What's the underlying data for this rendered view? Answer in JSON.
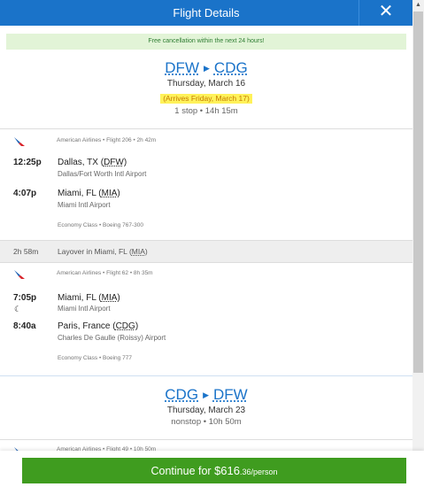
{
  "header": {
    "title": "Flight Details",
    "close_icon": "close-icon"
  },
  "notice": "Free cancellation within the next 24 hours!",
  "outbound": {
    "from": "DFW",
    "to": "CDG",
    "date": "Thursday, March 16",
    "arrives": "(Arrives Friday, March 17)",
    "stops": "1 stop • 14h 15m"
  },
  "segments": [
    {
      "airline": "American Airlines • Flight 206 • 2h 42m",
      "depart_time": "12:25p",
      "depart_city": "Dallas, TX",
      "depart_code": "DFW",
      "depart_airport": "Dallas/Fort Worth Intl Airport",
      "arrive_time": "4:07p",
      "arrive_city": "Miami, FL",
      "arrive_code": "MIA",
      "arrive_airport": "Miami Intl Airport",
      "cabin": "Economy Class • Boeing 767-300"
    },
    {
      "airline": "American Airlines • Flight 62 • 8h 35m",
      "depart_time": "7:05p",
      "depart_city": "Miami, FL",
      "depart_code": "MIA",
      "depart_airport": "Miami Intl Airport",
      "arrive_time": "8:40a",
      "arrive_city": "Paris, France",
      "arrive_code": "CDG",
      "arrive_airport": "Charles De Gaulle (Roissy) Airport",
      "cabin": "Economy Class • Boeing 777"
    }
  ],
  "layover": {
    "duration": "2h 58m",
    "text": "Layover in Miami, FL",
    "code": "MIA"
  },
  "return": {
    "from": "CDG",
    "to": "DFW",
    "date": "Thursday, March 23",
    "stops": "nonstop • 10h 50m",
    "airline_partial": "American Airlines • Flight 49 • 10h 50m"
  },
  "footer": {
    "label": "Continue for ",
    "price": "$616",
    "cents": ".36/person"
  },
  "colors": {
    "primary": "#1a73c9",
    "button": "#3f9c1f",
    "highlight": "#fff25a",
    "notice_bg": "#e2f4d7"
  }
}
